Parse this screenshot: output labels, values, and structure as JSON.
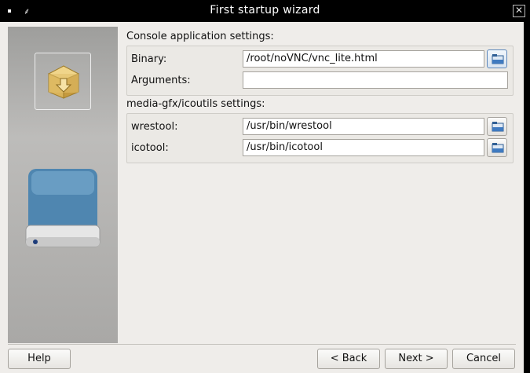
{
  "window": {
    "title": "First startup wizard",
    "pin_glyph": "⸙",
    "close_glyph": "✕"
  },
  "console_section": {
    "title": "Console application settings:",
    "binary_label": "Binary:",
    "binary_value": "/root/noVNC/vnc_lite.html",
    "arguments_label": "Arguments:",
    "arguments_value": ""
  },
  "icoutils_section": {
    "title": "media-gfx/icoutils settings:",
    "wrestool_label": "wrestool:",
    "wrestool_value": "/usr/bin/wrestool",
    "icotool_label": "icotool:",
    "icotool_value": "/usr/bin/icotool"
  },
  "buttons": {
    "help": "Help",
    "back": "< Back",
    "next": "Next >",
    "cancel": "Cancel"
  },
  "icons": [
    "window-menu-icon",
    "pin-icon",
    "close-icon",
    "package-box-icon",
    "hard-drive-icon",
    "folder-browse-icon"
  ],
  "colors": {
    "titlebar": "#000000",
    "client_bg": "#efedea",
    "sidebar": "#a9a8a6",
    "drive_blue": "#4f86b0",
    "active_border": "#5e88bb"
  }
}
